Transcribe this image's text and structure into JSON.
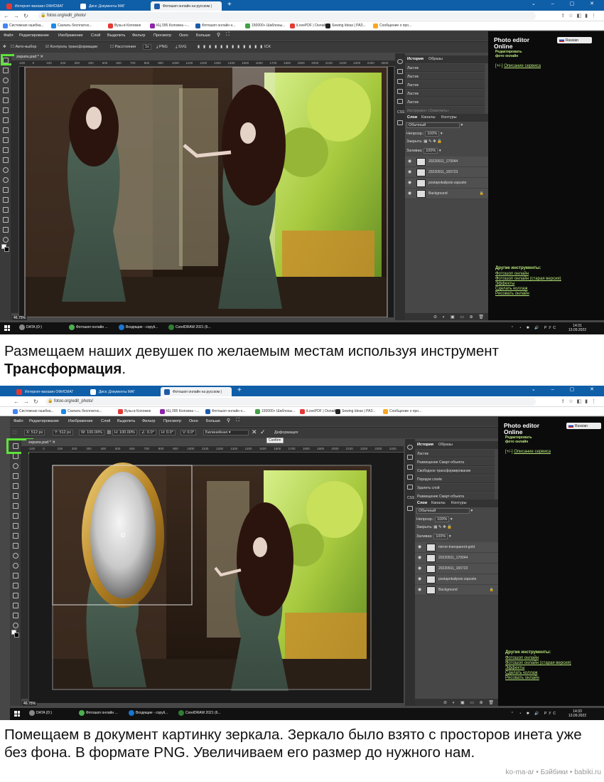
{
  "screenshot1": {
    "tabs": [
      {
        "label": "Интернет-магазин ОФИСМАГ"
      },
      {
        "label": "Диск: Документы МАГ"
      },
      {
        "label": "Фотошоп онлайн на русском |"
      }
    ],
    "url": "fotoo.org/edit_photo/",
    "bookmarks": [
      "Системная ошибка...",
      "Скачать бесплатно...",
      "Вузы в Коломне",
      "КЦ 095 Коломна –...",
      "Фотошоп онлайн н...",
      "150000+ Шаблоны...",
      "iLovePDF | Онлайн...",
      "Sewing Ideas | РАЗ...",
      "Сообщение о про..."
    ],
    "menu": [
      "Файл",
      "Редактирование",
      "Изображение",
      "Слой",
      "Выделить",
      "Фильтр",
      "Просмотр",
      "Окно",
      "Больше"
    ],
    "options": {
      "auto_select": "Авто-выбор",
      "transform_controls": "Контроль трансформации",
      "distances": "Расстояния",
      "zoom_factor": "1x",
      "png": "PNG",
      "svg": "SVG",
      "extra": "ICK"
    },
    "doc_tab": "zepuns.psd *",
    "ruler_ticks": [
      "-100",
      "0",
      "100",
      "200",
      "300",
      "400",
      "500",
      "600",
      "700",
      "800",
      "900",
      "1000",
      "1100",
      "1200",
      "1300",
      "1400",
      "1500",
      "1600",
      "1700",
      "1800",
      "1900",
      "2000",
      "2100",
      "2200",
      "2300",
      "2400",
      "2500"
    ],
    "zoom": "46.75%",
    "panel_tabs": [
      "История",
      "Образы"
    ],
    "history": [
      {
        "label": "Ластик",
        "dim": false
      },
      {
        "label": "Ластик",
        "dim": false
      },
      {
        "label": "Ластик",
        "dim": false
      },
      {
        "label": "Ластик",
        "dim": false
      },
      {
        "label": "Ластик",
        "dim": false
      },
      {
        "label": "Инструмент «Осветлить»",
        "dim": true
      }
    ],
    "layer_tabs": [
      "Слои",
      "Каналы",
      "Контуры"
    ],
    "blend_mode": "Обычный",
    "opacity_label": "Непрозр.:",
    "opacity_value": "100%",
    "lock_label": "Закрыть:",
    "fill_label": "Заливка:",
    "fill_value": "100%",
    "layers": [
      {
        "name": "20220911_170044"
      },
      {
        "name": "20220911_165723"
      },
      {
        "name": "postapokalipsis-zapuste"
      },
      {
        "name": "Background"
      }
    ],
    "sidebar": {
      "title1": "Photo editor",
      "title2": "Online",
      "sub1": "Редактировать",
      "sub2": "фото онлайн",
      "lang": "Russian",
      "service_prefix": "[+/-]",
      "service": "Описание сервиса",
      "tools_heading": "Другие инструменты:",
      "links": [
        "Фотошоп онлайн",
        "Фотошоп онлайн (старая версия)",
        "Эффекты",
        "Сделать коллаж",
        "Рисовать онлайн"
      ]
    },
    "taskbar": [
      "DATA (D:)",
      "Фотошоп онлайн ...",
      "Входящие - copyli...",
      "CorelDRAW 2021 (6..."
    ],
    "tray_lang": "РУС",
    "time": "14:31",
    "date": "13.09.2022"
  },
  "caption1": {
    "text": "Размещаем наших девушек по желаемым местам используя инструмент ",
    "bold": "Трансформация",
    "end": "."
  },
  "screenshot2": {
    "tabs": [
      {
        "label": "Интернет-магазин ОФИСМАГ"
      },
      {
        "label": "Диск: Документы МАГ"
      },
      {
        "label": "Фотошоп онлайн на русском |"
      }
    ],
    "url": "fotoo.org/edit_photo/",
    "bookmarks": [
      "Системная ошибка...",
      "Скачать бесплатно...",
      "Вузы в Коломне",
      "КЦ 095 Коломна –...",
      "Фотошоп онлайн н...",
      "150000+ Шаблоны...",
      "iLovePDF | Онлайн...",
      "Sewing Ideas | РАЗ...",
      "Сообщение о про..."
    ],
    "menu": [
      "Файл",
      "Редактирование",
      "Изображение",
      "Слой",
      "Выделить",
      "Фильтр",
      "Просмотр",
      "Окно",
      "Больше"
    ],
    "options": {
      "x_label": "X:",
      "x_value": "512 px",
      "y_label": "Y:",
      "y_value": "512 px",
      "w_value": "100.00%",
      "h_value": "100.00%",
      "angle_value": "0.0°",
      "h_skew": "0.0°",
      "v_skew": "0.0°",
      "interp": "Билинейная",
      "deform": "Деформация",
      "confirm_tip": "Confirm"
    },
    "doc_tab": "zepuns.psd *",
    "ruler_ticks": [
      "-100",
      "0",
      "100",
      "200",
      "300",
      "400",
      "500",
      "600",
      "700",
      "800",
      "900",
      "1000",
      "1100",
      "1200",
      "1300",
      "1400",
      "1500",
      "1600",
      "1700",
      "1800",
      "1900",
      "2000",
      "2100",
      "2200",
      "2300",
      "2400"
    ],
    "zoom": "46.75%",
    "panel_tabs": [
      "История",
      "Образы"
    ],
    "history": [
      {
        "label": "Ластик",
        "dim": false
      },
      {
        "label": "Размещение Смарт-объекта",
        "dim": false
      },
      {
        "label": "Свободное трансформирование",
        "dim": false
      },
      {
        "label": "Порядок слоёв",
        "dim": false
      },
      {
        "label": "Удалить слой",
        "dim": false
      },
      {
        "label": "Размещение Смарт-объекта",
        "dim": false
      }
    ],
    "layer_tabs": [
      "Слои",
      "Каналы",
      "Контуры"
    ],
    "blend_mode": "Обычный",
    "opacity_label": "Непрозр.:",
    "opacity_value": "100%",
    "lock_label": "Закрыть:",
    "fill_label": "Заливка:",
    "fill_value": "100%",
    "layers": [
      {
        "name": "mirror-transparent-gold"
      },
      {
        "name": "20220911_170044"
      },
      {
        "name": "20220911_165723"
      },
      {
        "name": "postapokalipsis-zapuste"
      },
      {
        "name": "Background"
      }
    ],
    "sidebar": {
      "title1": "Photo editor",
      "title2": "Online",
      "sub1": "Редактировать",
      "sub2": "фото онлайн",
      "lang": "Russian",
      "service_prefix": "[+/-]",
      "service": "Описание сервиса",
      "tools_heading": "Другие инструменты:",
      "links": [
        "Фотошоп онлайн",
        "Фотошоп онлайн (старая версия)",
        "Эффекты",
        "Сделать коллаж",
        "Рисовать онлайн"
      ]
    },
    "taskbar": [
      "DATA (D:)",
      "Фотошоп онлайн ...",
      "Входящие - copyli...",
      "CorelDRAW 2021 (6..."
    ],
    "tray_lang": "РУС",
    "time": "14:33",
    "date": "13.09.2022"
  },
  "caption2": {
    "text": "Помещаем в документ картинку зеркала. Зеркало было взято с просторов инета уже без фона. В формате PNG. Увеличиваем его размер до нужного нам."
  },
  "watermark": "ko-ma-ar • Бэйбики • babiki.ru",
  "colors": {
    "accent_green": "#5fe23c",
    "sidebar_link": "#b7e87a",
    "chrome_blue": "#0f5ea8"
  }
}
